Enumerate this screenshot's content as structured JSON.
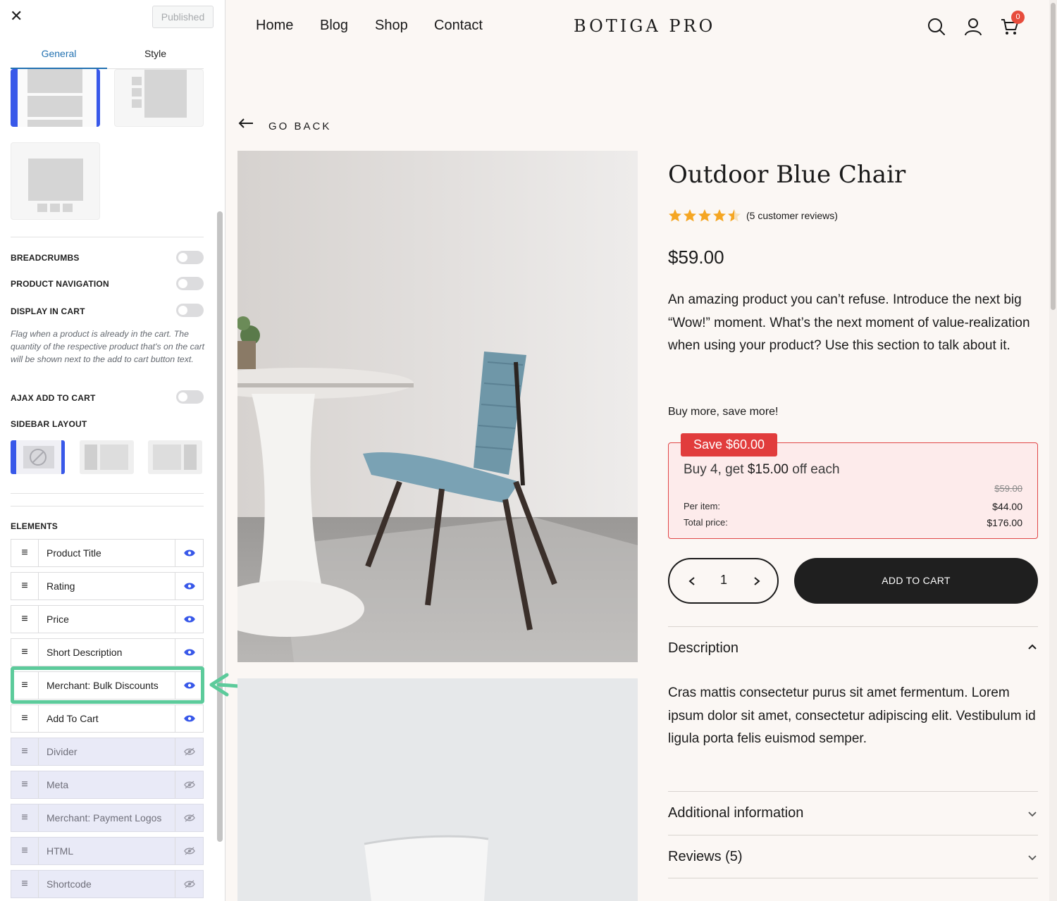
{
  "panel": {
    "status_button": "Published",
    "tabs": [
      "General",
      "Style"
    ],
    "options": {
      "breadcrumbs": {
        "label": "BREADCRUMBS",
        "on": false
      },
      "product_navigation": {
        "label": "PRODUCT NAVIGATION",
        "on": false
      },
      "display_in_cart": {
        "label": "DISPLAY IN CART",
        "on": false
      },
      "display_in_cart_help": "Flag when a product is already in the cart. The quantity of the respective product that's on the cart will be shown next to the add to cart button text.",
      "ajax_add_to_cart": {
        "label": "AJAX ADD TO CART",
        "on": false
      }
    },
    "sidebar_layout_label": "SIDEBAR LAYOUT",
    "elements_label": "ELEMENTS",
    "elements": [
      {
        "name": "Product Title",
        "visible": true
      },
      {
        "name": "Rating",
        "visible": true
      },
      {
        "name": "Price",
        "visible": true
      },
      {
        "name": "Short Description",
        "visible": true
      },
      {
        "name": "Merchant: Bulk Discounts",
        "visible": true
      },
      {
        "name": "Add To Cart",
        "visible": true
      },
      {
        "name": "Divider",
        "visible": false
      },
      {
        "name": "Meta",
        "visible": false
      },
      {
        "name": "Merchant: Payment Logos",
        "visible": false
      },
      {
        "name": "HTML",
        "visible": false
      },
      {
        "name": "Shortcode",
        "visible": false
      }
    ],
    "accent_color": "#3858e9",
    "highlight_color": "#5ccb9b"
  },
  "store": {
    "nav": [
      "Home",
      "Blog",
      "Shop",
      "Contact"
    ],
    "logo": "BOTIGA PRO",
    "cart_count": "0",
    "go_back": "GO BACK",
    "product": {
      "title": "Outdoor Blue Chair",
      "rating": 4.5,
      "reviews_text": "(5 customer reviews)",
      "price": "$59.00",
      "short_description": "An amazing product you can’t refuse. Introduce the next big “Wow!” moment. What’s the next moment of value-realization when using your product? Use this section to talk about it."
    },
    "bulk": {
      "heading": "Buy more, save more!",
      "save_badge": "Save $60.00",
      "offer_prefix": "Buy 4, get ",
      "offer_amount": "$15.00",
      "offer_suffix": " off each",
      "original_price": "$59.00",
      "per_item_label": "Per item:",
      "per_item_value": "$44.00",
      "total_label": "Total price:",
      "total_value": "$176.00"
    },
    "quantity": "1",
    "add_to_cart": "ADD TO CART",
    "accordion": {
      "description_title": "Description",
      "description_body": "Cras mattis consectetur purus sit amet fermentum. Lorem ipsum dolor sit amet, consectetur adipiscing elit. Vestibulum id ligula porta felis euismod semper.",
      "additional_title": "Additional information",
      "reviews_title": "Reviews (5)"
    },
    "colors": {
      "badge": "#e13c3c",
      "button": "#1f1f1f",
      "background": "#fbf7f4",
      "star": "#f5a623"
    }
  }
}
